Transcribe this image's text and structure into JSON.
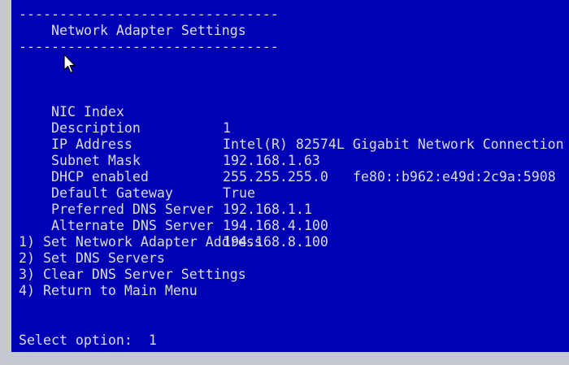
{
  "console": {
    "rule_top": "--------------------------------",
    "title": "Network Adapter Settings",
    "rule_bottom": "--------------------------------",
    "fields": [
      {
        "label": "NIC Index",
        "value": "1",
        "extra": ""
      },
      {
        "label": "Description",
        "value": "Intel(R) 82574L Gigabit Network Connection",
        "extra": ""
      },
      {
        "label": "IP Address",
        "value": "192.168.1.63",
        "extra": "fe80::b962:e49d:2c9a:5908"
      },
      {
        "label": "Subnet Mask",
        "value": "255.255.255.0",
        "extra": ""
      },
      {
        "label": "DHCP enabled",
        "value": "True",
        "extra": ""
      },
      {
        "label": "Default Gateway",
        "value": "192.168.1.1",
        "extra": ""
      },
      {
        "label": "Preferred DNS Server",
        "value": "194.168.4.100",
        "extra": ""
      },
      {
        "label": "Alternate DNS Server",
        "value": "194.168.8.100",
        "extra": ""
      }
    ],
    "menu": [
      "1) Set Network Adapter Address",
      "2) Set DNS Servers",
      "3) Clear DNS Server Settings",
      "4) Return to Main Menu"
    ],
    "prompt": "Select option:  1"
  },
  "colors": {
    "background": "#0000b4",
    "text": "#dcdcdc",
    "frame": "#c4c8cf"
  },
  "icons": {
    "cursor": "arrow-pointer-icon"
  }
}
